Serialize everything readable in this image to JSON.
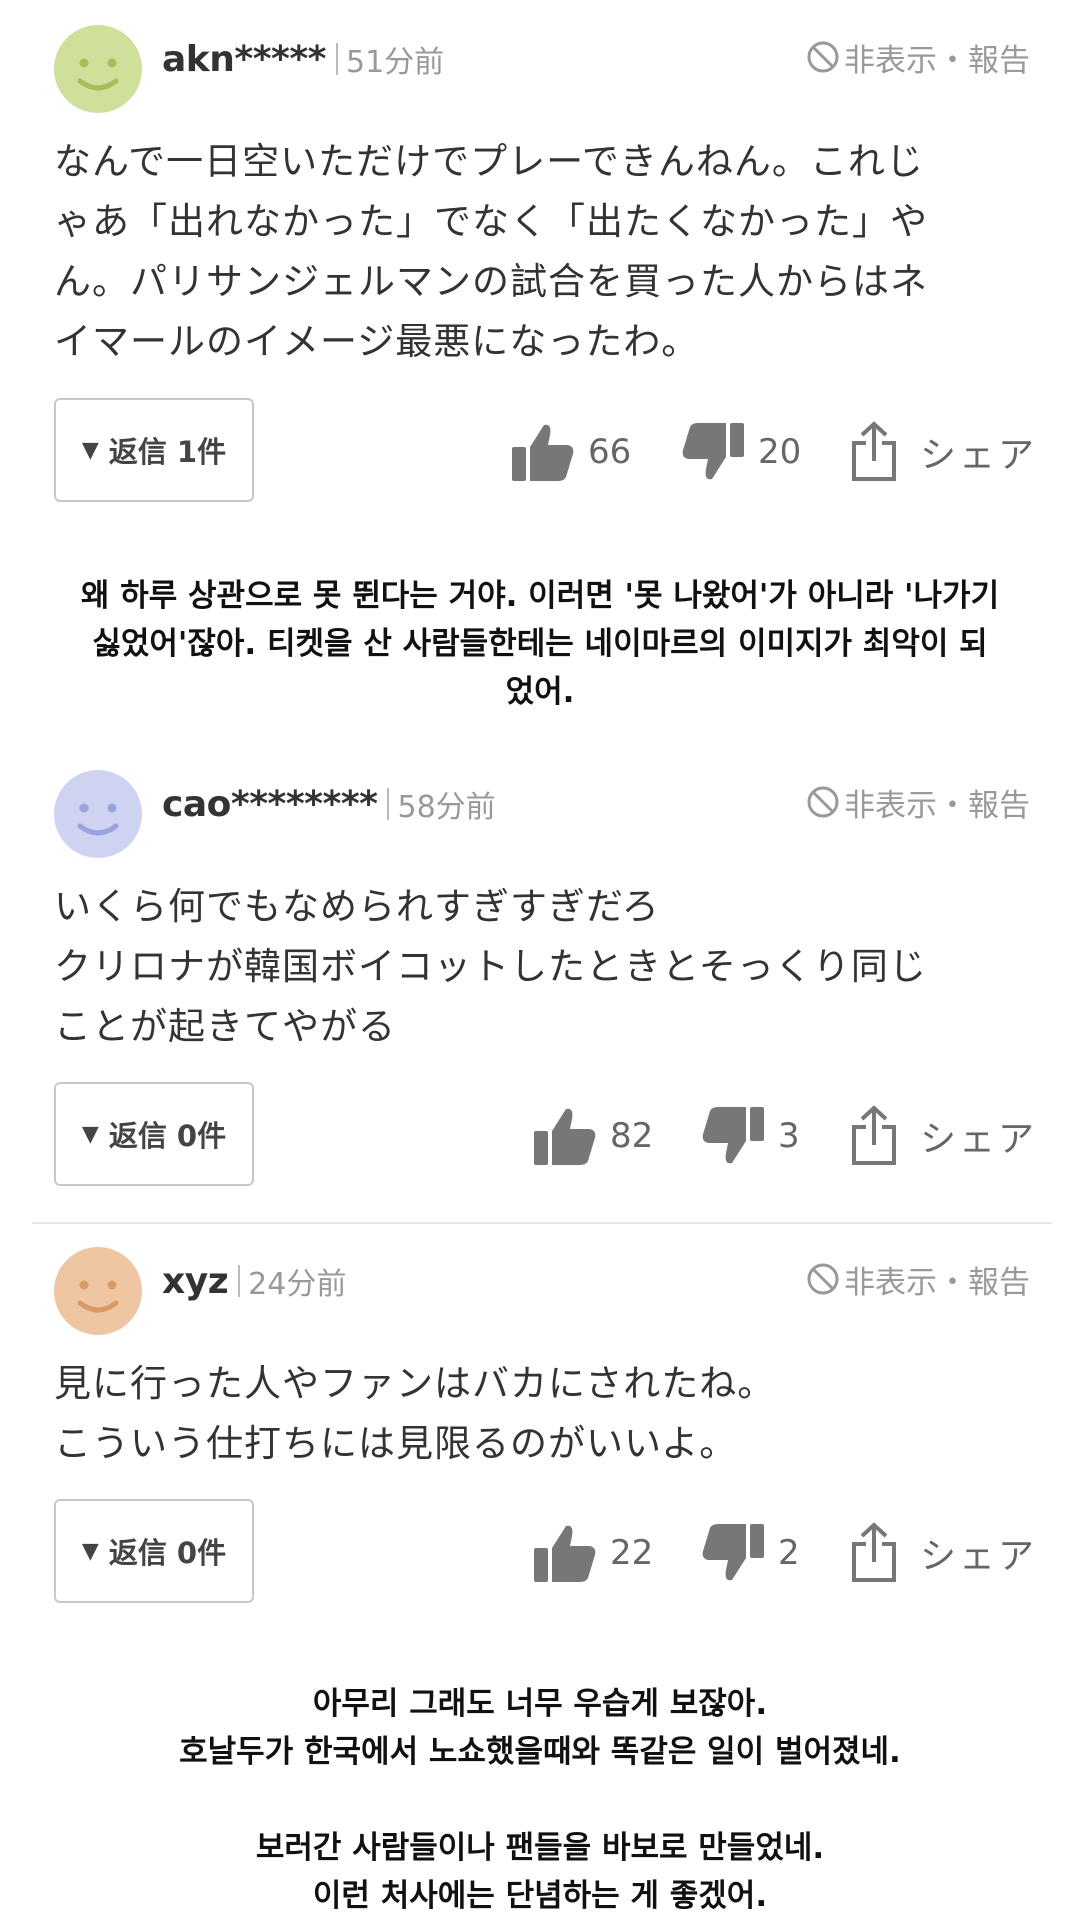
{
  "comments": [
    {
      "username": "akn*****",
      "time": "51分前",
      "report_label": "非表示・報告",
      "avatar_color": "#cfe09a",
      "body": [
        "なんで一日空いただけでプレーできんねん。これじ",
        "ゃあ「出れなかった」でなく「出たくなかった」や",
        "ん。パリサンジェルマンの試合を買った人からはネ",
        "イマールのイメージ最悪になったわ。"
      ],
      "reply_label": "返信 1件",
      "likes": "66",
      "dislikes": "20",
      "share_label": "シェア"
    },
    {
      "username": "cao********",
      "time": "58分前",
      "report_label": "非表示・報告",
      "avatar_color": "#cfd3f2",
      "body": [
        "いくら何でもなめられすぎすぎだろ",
        "クリロナが韓国ボイコットしたときとそっくり同じ",
        "ことが起きてやがる"
      ],
      "reply_label": "返信 0件",
      "likes": "82",
      "dislikes": "3",
      "share_label": "シェア"
    },
    {
      "username": "xyz",
      "time": "24分前",
      "report_label": "非表示・報告",
      "avatar_color": "#efc6a2",
      "body": [
        "見に行った人やファンはバカにされたね。",
        "こういう仕打ちには見限るのがいいよ。"
      ],
      "reply_label": "返信 0件",
      "likes": "22",
      "dislikes": "2",
      "share_label": "シェア"
    }
  ],
  "translations": [
    {
      "lines": [
        "왜 하루 상관으로 못 뛴다는 거야. 이러면 '못 나왔어'가 아니라 '나가기",
        "싫었어'잖아. 티켓을 산 사람들한테는 네이마르의 이미지가 최악이 되",
        "었어."
      ]
    },
    {
      "lines": [
        "아무리 그래도 너무 우습게 보잖아.",
        "호날두가 한국에서 노쇼했을때와 똑같은 일이 벌어졌네.",
        "",
        "보러간 사람들이나 팬들을 바보로 만들었네.",
        "이런 처사에는 단념하는 게 좋겠어."
      ]
    }
  ],
  "icons": {
    "ban": "ban-icon",
    "like": "thumbs-up-icon",
    "dislike": "thumbs-down-icon",
    "share": "share-icon",
    "reply_toggle": "caret-down-icon"
  }
}
